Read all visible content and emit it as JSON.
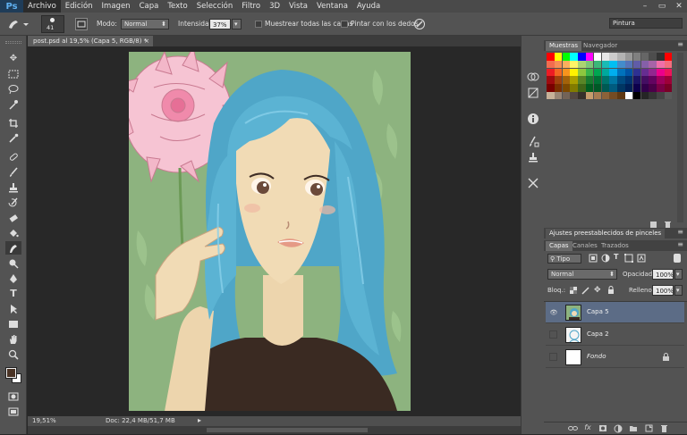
{
  "app": {
    "logo": "Ps"
  },
  "menu": [
    "Archivo",
    "Edición",
    "Imagen",
    "Capa",
    "Texto",
    "Selección",
    "Filtro",
    "3D",
    "Vista",
    "Ventana",
    "Ayuda"
  ],
  "window_controls": {
    "minimize": "–",
    "restore": "▭",
    "close": "✕"
  },
  "options_bar": {
    "brush_size": "41",
    "mode_label": "Modo:",
    "mode_value": "Normal",
    "intensity_label": "Intensidad:",
    "intensity_value": "37%",
    "sample_all_label": "Muestrear todas las capas",
    "finger_paint_label": "Pintar con los dedos",
    "workspace": "Pintura"
  },
  "document": {
    "tab_title": "post.psd al 19,5% (Capa 5, RGB/8) *",
    "tab_close": "×",
    "zoom": "19,51%",
    "doc_info": "Doc: 22,4 MB/51,7 MB"
  },
  "swatches_panel": {
    "tabs": [
      "Muestras",
      "Navegador"
    ],
    "colors": [
      "#ff0000",
      "#ffff00",
      "#00ff00",
      "#00ffff",
      "#0000ff",
      "#ff00ff",
      "#ffffff",
      "#e6e6e6",
      "#cccccc",
      "#b3b3b3",
      "#999999",
      "#808080",
      "#666666",
      "#4d4d4d",
      "#333333",
      "#ff0000",
      "#f26c4f",
      "#f68e56",
      "#fbaf5d",
      "#fff467",
      "#acd372",
      "#7cc576",
      "#3bb878",
      "#1abbb4",
      "#00bff3",
      "#438ccb",
      "#5574b9",
      "#605ca8",
      "#855fa8",
      "#a763a8",
      "#f06ea9",
      "#f26d7d",
      "#ed1c24",
      "#f26522",
      "#f7941d",
      "#fff200",
      "#8dc73f",
      "#39b54a",
      "#00a651",
      "#00a99d",
      "#00aeef",
      "#0072bc",
      "#0054a6",
      "#2e3192",
      "#662d91",
      "#92278f",
      "#ec008c",
      "#ed145b",
      "#9e0b0f",
      "#a0410d",
      "#a3620a",
      "#aba000",
      "#598527",
      "#197b30",
      "#007236",
      "#00746b",
      "#0076a3",
      "#004a80",
      "#003471",
      "#1b1464",
      "#440e62",
      "#630460",
      "#9e005d",
      "#9e0039",
      "#790000",
      "#7b2e00",
      "#7d4900",
      "#827b00",
      "#406618",
      "#005e20",
      "#005826",
      "#005952",
      "#005b7f",
      "#003663",
      "#002157",
      "#0d004c",
      "#32004b",
      "#4b0049",
      "#7b0046",
      "#7a0026",
      "#c7b299",
      "#998675",
      "#736357",
      "#534741",
      "#37302a",
      "#c69c6d",
      "#a67c52",
      "#8c6239",
      "#754c24",
      "#603913",
      "#ffffff",
      "#000000",
      "#252525",
      "#353535",
      "#454545",
      "#5a5a5a"
    ]
  },
  "brush_presets_panel": {
    "title": "Ajustes preestablecidos de pinceles"
  },
  "layers_panel": {
    "tabs": [
      "Capas",
      "Canales",
      "Trazados"
    ],
    "filter_kind": "Tipo",
    "blend_mode": "Normal",
    "opacity_label": "Opacidad:",
    "opacity_value": "100%",
    "lock_label": "Bloq.:",
    "fill_label": "Relleno:",
    "fill_value": "100%",
    "layers": [
      {
        "name": "Capa 5",
        "selected": true,
        "visible": true
      },
      {
        "name": "Capa 2",
        "selected": false,
        "visible": false
      },
      {
        "name": "Fondo",
        "selected": false,
        "visible": false,
        "italic": true,
        "locked": true
      }
    ]
  },
  "colors": {
    "foreground": "#4a3325",
    "background": "#ffffff",
    "selection": "#5c6c86",
    "hair": "#4fa6c8"
  }
}
